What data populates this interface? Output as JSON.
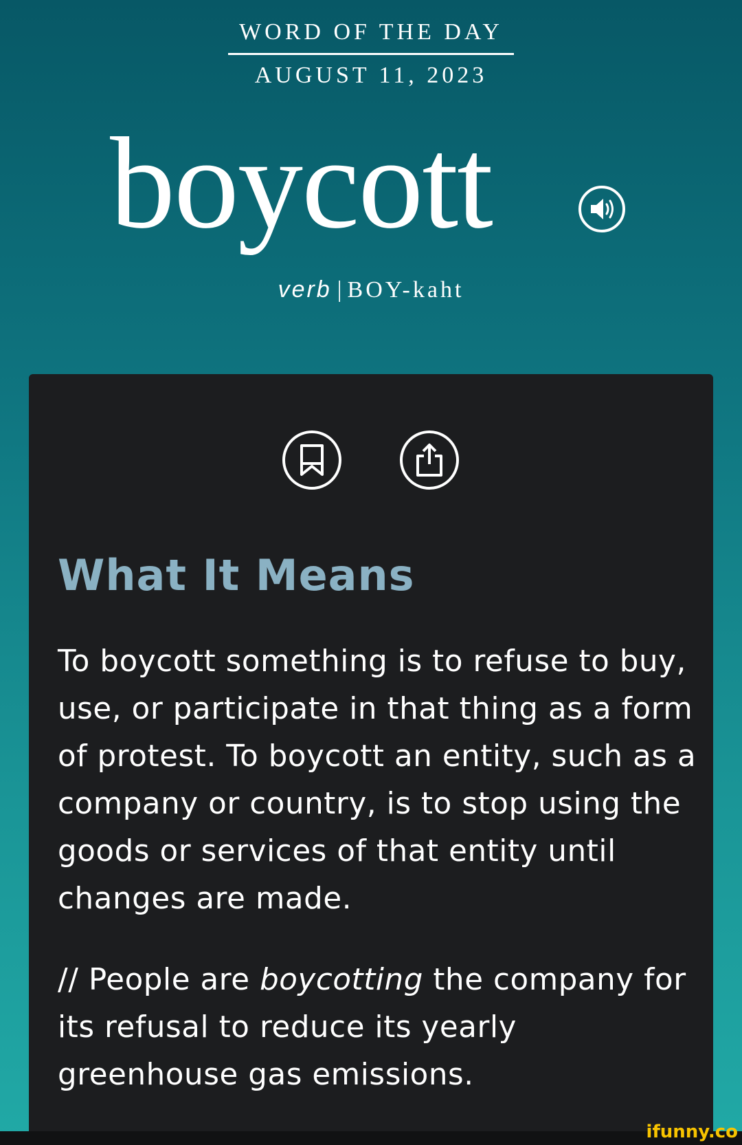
{
  "header": {
    "label": "WORD OF THE DAY",
    "date": "AUGUST 11, 2023"
  },
  "word": {
    "text": "boycott",
    "part_of_speech": "verb",
    "separator": "|",
    "pronunciation": "BOY-kaht",
    "audio_icon": "speaker-icon"
  },
  "actions": {
    "save_icon": "bookmark-icon",
    "share_icon": "share-icon"
  },
  "meaning": {
    "heading": "What It Means",
    "definition": "To boycott something is to refuse to buy, use, or participate in that thing as a form of protest. To boycott an entity, such as a company or country, is to stop using the goods or services of that entity until changes are made.",
    "example_prefix": "// People are ",
    "example_em": "boycotting",
    "example_suffix": " the company for its refusal to reduce its yearly greenhouse gas emissions."
  },
  "watermark": "ifunny.co",
  "colors": {
    "accent_heading": "#8ab1c3",
    "card_bg": "#1c1d1f",
    "teal_top": "#075866",
    "teal_bottom": "#21a9a6"
  }
}
